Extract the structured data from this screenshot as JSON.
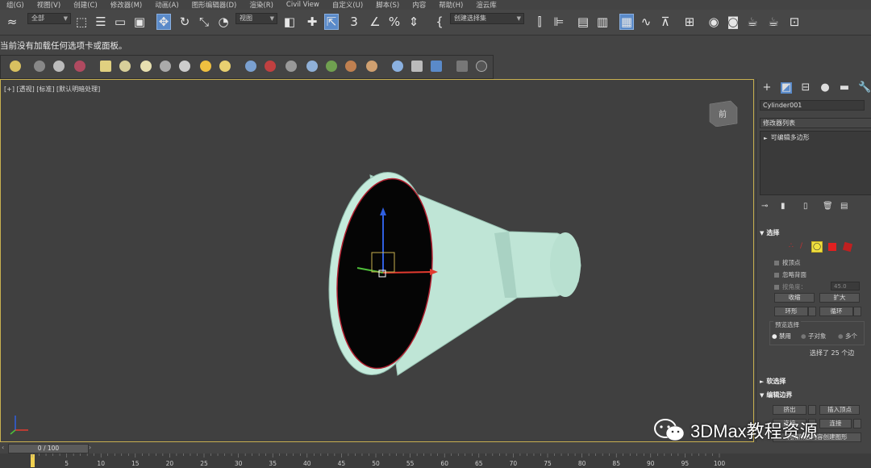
{
  "menubar": {
    "items": [
      "组(G)",
      "视图(V)",
      "创建(C)",
      "修改器(M)",
      "动画(A)",
      "图形编辑器(D)",
      "渲染(R)",
      "Civil View",
      "自定义(U)",
      "脚本(S)",
      "内容",
      "帮助(H)",
      "渲云库"
    ]
  },
  "toolbar": {
    "filter_dropdown": "全部",
    "refcoord_dropdown": "视图",
    "selection_set_dropdown": "创建选择集",
    "active_color": "#5a8ac9"
  },
  "status": {
    "message": "当前没有加载任何选项卡或面板。"
  },
  "viewport": {
    "label": "[+] [透视] [标准] [默认明暗处理]",
    "viewcube_label": "前",
    "background_color": "#404040",
    "object_color": "#bfe5d6",
    "axis_colors": {
      "x": "#e23a2f",
      "y": "#4fbf3a",
      "z": "#2f5fe0"
    }
  },
  "command_panel": {
    "object_name": "Cylinder001",
    "modifier_list_label": "修改器列表",
    "modifier_stack": [
      "可编辑多边形"
    ],
    "selection_section": "选择",
    "by_vertex": "按顶点",
    "ignore_backfacing": "忽略背面",
    "angle_label": "按角度：",
    "angle_value": "45.0",
    "shrink": "收缩",
    "grow": "扩大",
    "ring": "环形",
    "loop": "循环",
    "preview_label": "预览选择",
    "preview_options": [
      "禁用",
      "子对象",
      "多个"
    ],
    "selection_info": "选择了 25 个边",
    "soft_selection": "软选择",
    "edit_edges": "编辑边界",
    "extrude": "挤出",
    "insert_vertex": "插入顶点",
    "create_shape": "利用所选内容创建图形",
    "bridge": "连接",
    "connect": "连接"
  },
  "timeline": {
    "slider": "0 / 100",
    "ticks": [
      "5",
      "10",
      "15",
      "20",
      "25",
      "30",
      "35",
      "40",
      "45",
      "50",
      "55",
      "60",
      "65",
      "70",
      "75",
      "80",
      "85",
      "90",
      "95",
      "100"
    ]
  },
  "watermark": {
    "text": "3DMax教程资源"
  }
}
